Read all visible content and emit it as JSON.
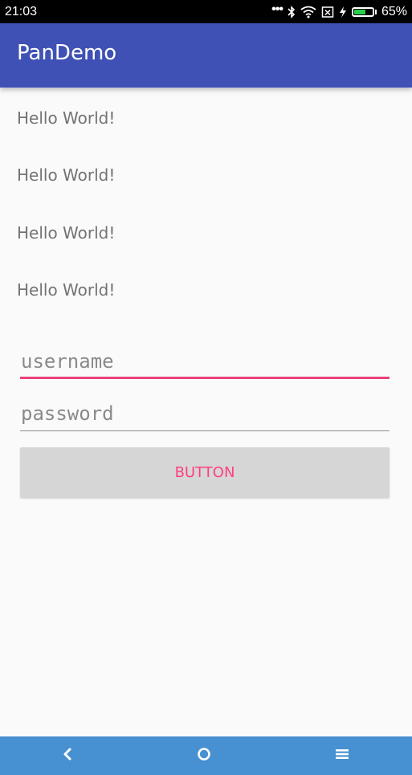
{
  "status_bar": {
    "time": "21:03",
    "icons": [
      "more-dots-icon",
      "bluetooth-icon",
      "wifi-icon",
      "no-sim-icon",
      "charging-icon",
      "battery-icon"
    ],
    "battery_percent": "65%",
    "battery_level": 0.65,
    "battery_color": "#27d04a"
  },
  "app_bar": {
    "title": "PanDemo",
    "color": "#3f51b5"
  },
  "main": {
    "hello_texts": [
      "Hello World!",
      "Hello World!",
      "Hello World!",
      "Hello World!"
    ],
    "username": {
      "placeholder": "username",
      "value": ""
    },
    "password": {
      "placeholder": "password",
      "value": ""
    },
    "button_label": "BUTTON",
    "accent_color": "#ff4081"
  },
  "nav_bar": {
    "items": [
      "back-icon",
      "home-icon",
      "menu-icon"
    ],
    "color": "#4790d1"
  }
}
